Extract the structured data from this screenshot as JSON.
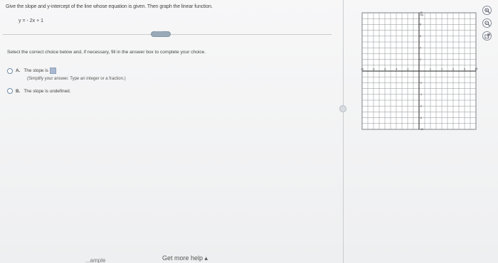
{
  "question": {
    "prompt": "Give the slope and y-intercept of the line whose equation is given. Then graph the linear function.",
    "equation": "y = - 2x + 1"
  },
  "instruction": "Select the correct choice below and, if necessary, fill in the answer box to complete your choice.",
  "choices": [
    {
      "letter": "A.",
      "text": "The slope is",
      "hint": "(Simplify your answer. Type an integer or a fraction.)",
      "selected": false
    },
    {
      "letter": "B.",
      "text": "The slope is undefined.",
      "selected": false
    }
  ],
  "footer": {
    "example_label": "...ample",
    "help_label": "Get more help ▴"
  },
  "graph": {
    "x_min": -10,
    "x_max": 10,
    "y_min": -10,
    "y_max": 10,
    "axis_label_x": "x",
    "axis_label_y": "Ay",
    "tick_labels_x": [
      "-10",
      "-8",
      "-6",
      "-4",
      "-2",
      "2",
      "4",
      "6",
      "8",
      "10"
    ],
    "tick_labels_y": [
      "10",
      "8",
      "6",
      "4",
      "2",
      "-2",
      "-4",
      "-6",
      "-8",
      "-10"
    ],
    "grid": true
  },
  "tools": [
    "zoom-in-icon",
    "zoom-out-icon",
    "external-link-icon"
  ],
  "colors": {
    "answer_box": "#a9b8cf",
    "radio_border": "#6f8aa3",
    "grid": "#8d8f92"
  }
}
